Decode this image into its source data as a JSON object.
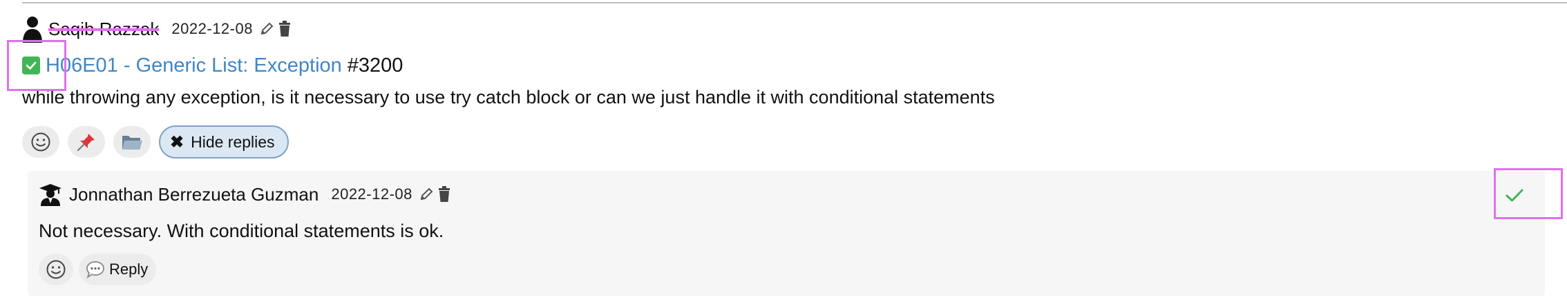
{
  "post": {
    "author": "Saqib Razzak",
    "date": "2022-12-08",
    "title": "H06E01 - Generic List: Exception",
    "number": "#3200",
    "body": "while throwing any exception, is it necessary to use try catch block or can we just handle it with conditional statements",
    "hide_replies_label": "Hide replies"
  },
  "reply": {
    "author": "Jonnathan Berrezueta Guzman",
    "date": "2022-12-08",
    "body": "Not necessary. With conditional statements is ok.",
    "reply_label": "Reply"
  },
  "icons": {
    "author": "person-icon",
    "edit": "pencil-icon",
    "delete": "trash-icon",
    "solved": "check-badge-icon",
    "emoji": "smiley-icon",
    "pin": "pushpin-icon",
    "archive": "folder-icon",
    "hide": "x-icon",
    "reply_author": "graduation-cap-icon",
    "reply": "speech-bubble-icon",
    "accept": "check-icon"
  },
  "colors": {
    "link": "#3f86c7",
    "solved": "#43b556",
    "highlight": "#e070ee",
    "hide_button_bg": "#dbe8f4",
    "reply_bg": "#f6f6f6"
  }
}
